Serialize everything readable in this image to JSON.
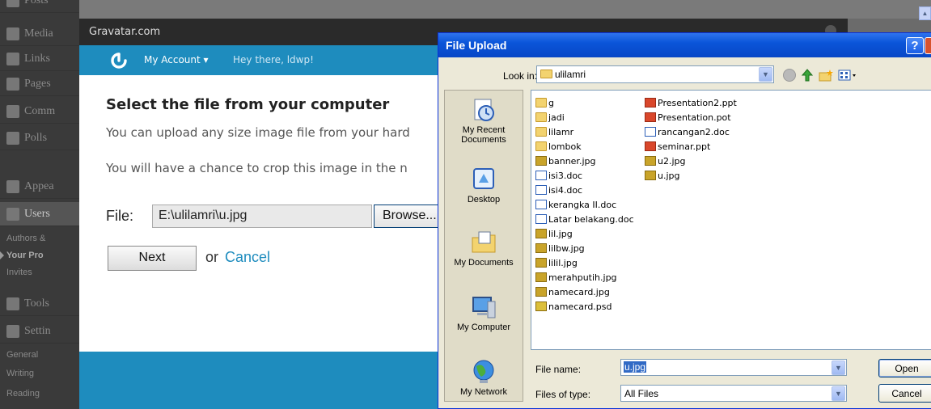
{
  "wp_sidebar": {
    "items": [
      {
        "label": "Posts"
      },
      {
        "label": "Media"
      },
      {
        "label": "Links"
      },
      {
        "label": "Pages"
      },
      {
        "label": "Comm"
      },
      {
        "label": "Polls"
      },
      {
        "label": "Appea"
      },
      {
        "label": "Users"
      },
      {
        "label": "Tools"
      },
      {
        "label": "Settin"
      }
    ],
    "users_sub": [
      "Authors &",
      "Your Pro",
      "Invites"
    ],
    "settings_sub": [
      "General",
      "Writing",
      "Reading"
    ]
  },
  "gravatar": {
    "window_title": "Gravatar.com",
    "my_account": "My Account ▾",
    "greeting": "Hey there, ldwp!",
    "heading": "Select the file from your computer",
    "line1": "You can upload any size image file from your hard",
    "line2": "You will have a chance to crop this image in the n",
    "file_label": "File:",
    "file_value": "E:\\ulilamri\\u.jpg",
    "browse_label": "Browse...",
    "next_label": "Next",
    "or_text": "or",
    "cancel_label": "Cancel"
  },
  "dialog": {
    "title": "File Upload",
    "help": "?",
    "look_in_label": "Look in:",
    "look_in_value": "ulilamri",
    "places": [
      "My Recent Documents",
      "Desktop",
      "My Documents",
      "My Computer",
      "My Network"
    ],
    "files_col1": [
      {
        "name": "g",
        "type": "folder"
      },
      {
        "name": "jadi",
        "type": "folder"
      },
      {
        "name": "lilamr",
        "type": "folder"
      },
      {
        "name": "lombok",
        "type": "folder"
      },
      {
        "name": "banner.jpg",
        "type": "jpg"
      },
      {
        "name": "isi3.doc",
        "type": "doc"
      },
      {
        "name": "isi4.doc",
        "type": "doc"
      },
      {
        "name": "kerangka II.doc",
        "type": "doc"
      },
      {
        "name": "Latar belakang.doc",
        "type": "doc"
      },
      {
        "name": "lil.jpg",
        "type": "jpg"
      },
      {
        "name": "lilbw.jpg",
        "type": "jpg"
      },
      {
        "name": "lilil.jpg",
        "type": "jpg"
      },
      {
        "name": "merahputih.jpg",
        "type": "jpg"
      },
      {
        "name": "namecard.jpg",
        "type": "jpg"
      },
      {
        "name": "namecard.psd",
        "type": "psd"
      }
    ],
    "files_col2": [
      {
        "name": "Presentation2.ppt",
        "type": "ppt"
      },
      {
        "name": "Presentation.pot",
        "type": "ppt"
      },
      {
        "name": "rancangan2.doc",
        "type": "doc"
      },
      {
        "name": "seminar.ppt",
        "type": "ppt"
      },
      {
        "name": "u2.jpg",
        "type": "jpg"
      },
      {
        "name": "u.jpg",
        "type": "jpg"
      }
    ],
    "file_name_label": "File name:",
    "file_name_value": "u.jpg",
    "file_type_label": "Files of type:",
    "file_type_value": "All Files",
    "open_label": "Open",
    "cancel_label": "Cancel"
  },
  "colors": {
    "gravatar_blue": "#1e8cbe",
    "xp_title_blue": "#0a55d9",
    "dialog_bg": "#ece9d8",
    "selection": "#316ac5"
  }
}
